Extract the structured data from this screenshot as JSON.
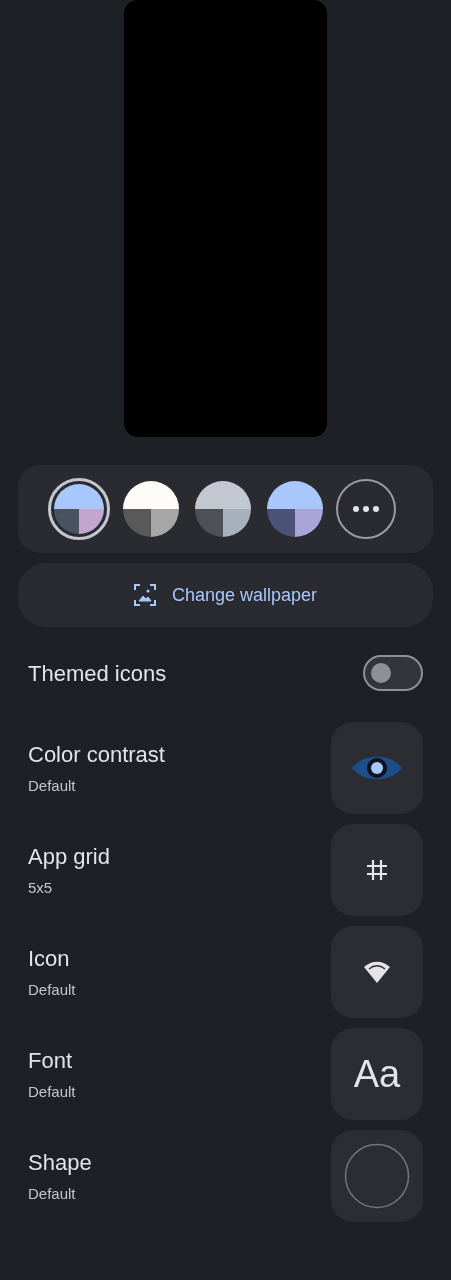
{
  "color_options": [
    {
      "selected": true,
      "segments": [
        {
          "color": "#a8c7fa"
        },
        {
          "color": "#4a5160"
        },
        {
          "color": "#c4a5cf"
        }
      ]
    },
    {
      "selected": false,
      "segments": [
        {
          "color": "#fefcf8"
        },
        {
          "color": "#595959"
        },
        {
          "color": "#a6a6a6"
        }
      ]
    },
    {
      "selected": false,
      "segments": [
        {
          "color": "#c3c7cf"
        },
        {
          "color": "#4d5057"
        },
        {
          "color": "#a7b0bd"
        }
      ]
    },
    {
      "selected": false,
      "segments": [
        {
          "color": "#a8c7fa"
        },
        {
          "color": "#4b5478"
        },
        {
          "color": "#aaa5d8"
        }
      ]
    }
  ],
  "change_wallpaper": "Change wallpaper",
  "themed_icons": {
    "label": "Themed icons",
    "on": false
  },
  "settings": [
    {
      "kind": "contrast",
      "title": "Color contrast",
      "value": "Default"
    },
    {
      "kind": "grid",
      "title": "App grid",
      "value": "5x5"
    },
    {
      "kind": "icon",
      "title": "Icon",
      "value": "Default"
    },
    {
      "kind": "font",
      "title": "Font",
      "value": "Default",
      "preview": "Aa"
    },
    {
      "kind": "shape",
      "title": "Shape",
      "value": "Default"
    }
  ]
}
